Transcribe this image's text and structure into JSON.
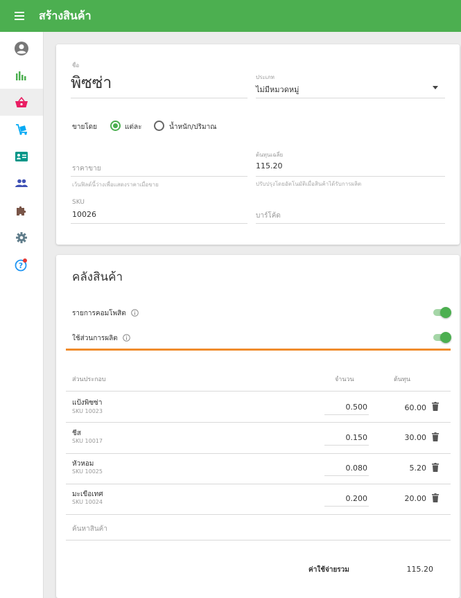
{
  "appbar": {
    "title": "สร้างสินค้า",
    "menu_icon": "hamburger-icon"
  },
  "colors": {
    "primary": "#4caf50",
    "accent_line": "#f08c2c",
    "badge": "#e53935"
  },
  "sidebar": {
    "items": [
      {
        "icon": "account-circle-icon",
        "active": false
      },
      {
        "icon": "bar-chart-icon",
        "active": false
      },
      {
        "icon": "basket-icon",
        "active": true
      },
      {
        "icon": "dolly-icon",
        "active": false
      },
      {
        "icon": "contact-card-icon",
        "active": false
      },
      {
        "icon": "people-icon",
        "active": false
      },
      {
        "icon": "puzzle-icon",
        "active": false
      },
      {
        "icon": "gear-icon",
        "active": false
      },
      {
        "icon": "help-icon",
        "active": false
      }
    ]
  },
  "product": {
    "name_label": "ชื่อ",
    "name_value": "พิซซ่า",
    "category_label": "ประเภท",
    "category_value": "ไม่มีหมวดหมู่",
    "sold_by_label": "ขายโดย",
    "sold_by_options": [
      "แต่ละ",
      "น้ำหนัก/ปริมาณ"
    ],
    "sold_by_selected": "แต่ละ",
    "price_placeholder": "ราคาขาย",
    "price_hint": "เว้นฟิลด์นี้ว่างเพื่อแสดงราคาเมื่อขาย",
    "cost_label": "ต้นทุนเฉลี่ย",
    "cost_value": "115.20",
    "cost_hint": "ปรับปรุงโดยอัตโนมัติเมื่อสินค้าได้รับการผลิต",
    "sku_label": "SKU",
    "sku_value": "10026",
    "barcode_placeholder": "บาร์โค้ด"
  },
  "inventory": {
    "title": "คลังสินค้า",
    "composite_label": "รายการคอมโพสิต",
    "composite_on": true,
    "production_label": "ใช้ส่วนการผลิต",
    "production_on": true,
    "table": {
      "col_component": "ส่วนประกอบ",
      "col_quantity": "จำนวน",
      "col_cost": "ต้นทุน",
      "rows": [
        {
          "name": "แป้งพิซซ่า",
          "sku": "SKU 10023",
          "qty": "0.500",
          "cost": "60.00"
        },
        {
          "name": "ชีส",
          "sku": "SKU 10017",
          "qty": "0.150",
          "cost": "30.00"
        },
        {
          "name": "หัวหอม",
          "sku": "SKU 10025",
          "qty": "0.080",
          "cost": "5.20"
        },
        {
          "name": "มะเขือเทศ",
          "sku": "SKU 10024",
          "qty": "0.200",
          "cost": "20.00"
        }
      ]
    },
    "search_placeholder": "ค้นหาสินค้า",
    "total_label": "ค่าใช้จ่ายรวม",
    "total_value": "115.20"
  }
}
